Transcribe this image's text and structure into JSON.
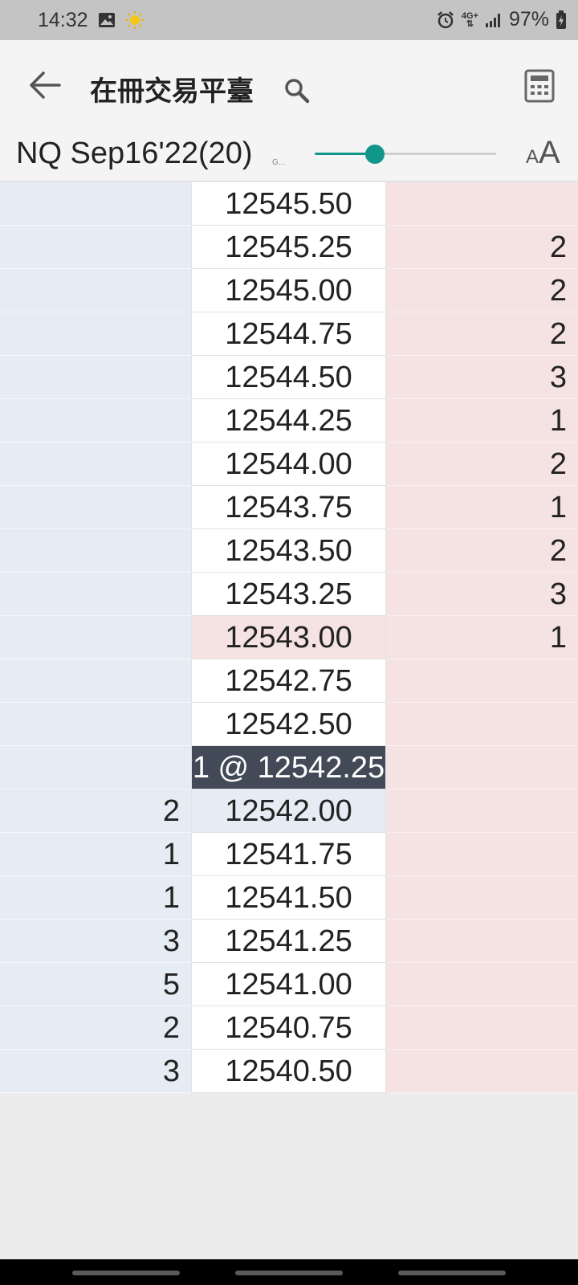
{
  "status_bar": {
    "time": "14:32",
    "network": [
      "4G+",
      "⇅"
    ],
    "battery": "97%",
    "icons": [
      "image-icon",
      "sun-icon",
      "alarm-icon",
      "network-4g-icon",
      "signal-icon",
      "battery-charging-icon"
    ]
  },
  "header": {
    "title": "在冊交易平臺",
    "icons": [
      "back-arrow-icon",
      "search-icon",
      "calculator-icon"
    ]
  },
  "instrument": {
    "name": "NQ Sep16'22(20)",
    "sub": "G...",
    "font_size_level": 0.33,
    "font_size_label_small": "A",
    "font_size_label_large": "A"
  },
  "colors": {
    "bid_bg": "#e6ecf3",
    "ask_bg": "#f5e2e2",
    "last_trade_bg": "#424a57",
    "accent": "#12968a"
  },
  "ladder": {
    "rows": [
      {
        "bid": "",
        "price": "12545.50",
        "ask": ""
      },
      {
        "bid": "",
        "price": "12545.25",
        "ask": "2"
      },
      {
        "bid": "",
        "price": "12545.00",
        "ask": "2"
      },
      {
        "bid": "",
        "price": "12544.75",
        "ask": "2"
      },
      {
        "bid": "",
        "price": "12544.50",
        "ask": "3"
      },
      {
        "bid": "",
        "price": "12544.25",
        "ask": "1"
      },
      {
        "bid": "",
        "price": "12544.00",
        "ask": "2"
      },
      {
        "bid": "",
        "price": "12543.75",
        "ask": "1"
      },
      {
        "bid": "",
        "price": "12543.50",
        "ask": "2"
      },
      {
        "bid": "",
        "price": "12543.25",
        "ask": "3"
      },
      {
        "bid": "",
        "price": "12543.00",
        "ask": "1",
        "state": "best-ask"
      },
      {
        "bid": "",
        "price": "12542.75",
        "ask": ""
      },
      {
        "bid": "",
        "price": "12542.50",
        "ask": ""
      },
      {
        "bid": "",
        "price": "1 @ 12542.25",
        "ask": "",
        "state": "last-trade"
      },
      {
        "bid": "2",
        "price": "12542.00",
        "ask": "",
        "state": "best-bid"
      },
      {
        "bid": "1",
        "price": "12541.75",
        "ask": ""
      },
      {
        "bid": "1",
        "price": "12541.50",
        "ask": ""
      },
      {
        "bid": "3",
        "price": "12541.25",
        "ask": ""
      },
      {
        "bid": "5",
        "price": "12541.00",
        "ask": ""
      },
      {
        "bid": "2",
        "price": "12540.75",
        "ask": ""
      },
      {
        "bid": "3",
        "price": "12540.50",
        "ask": ""
      }
    ]
  }
}
